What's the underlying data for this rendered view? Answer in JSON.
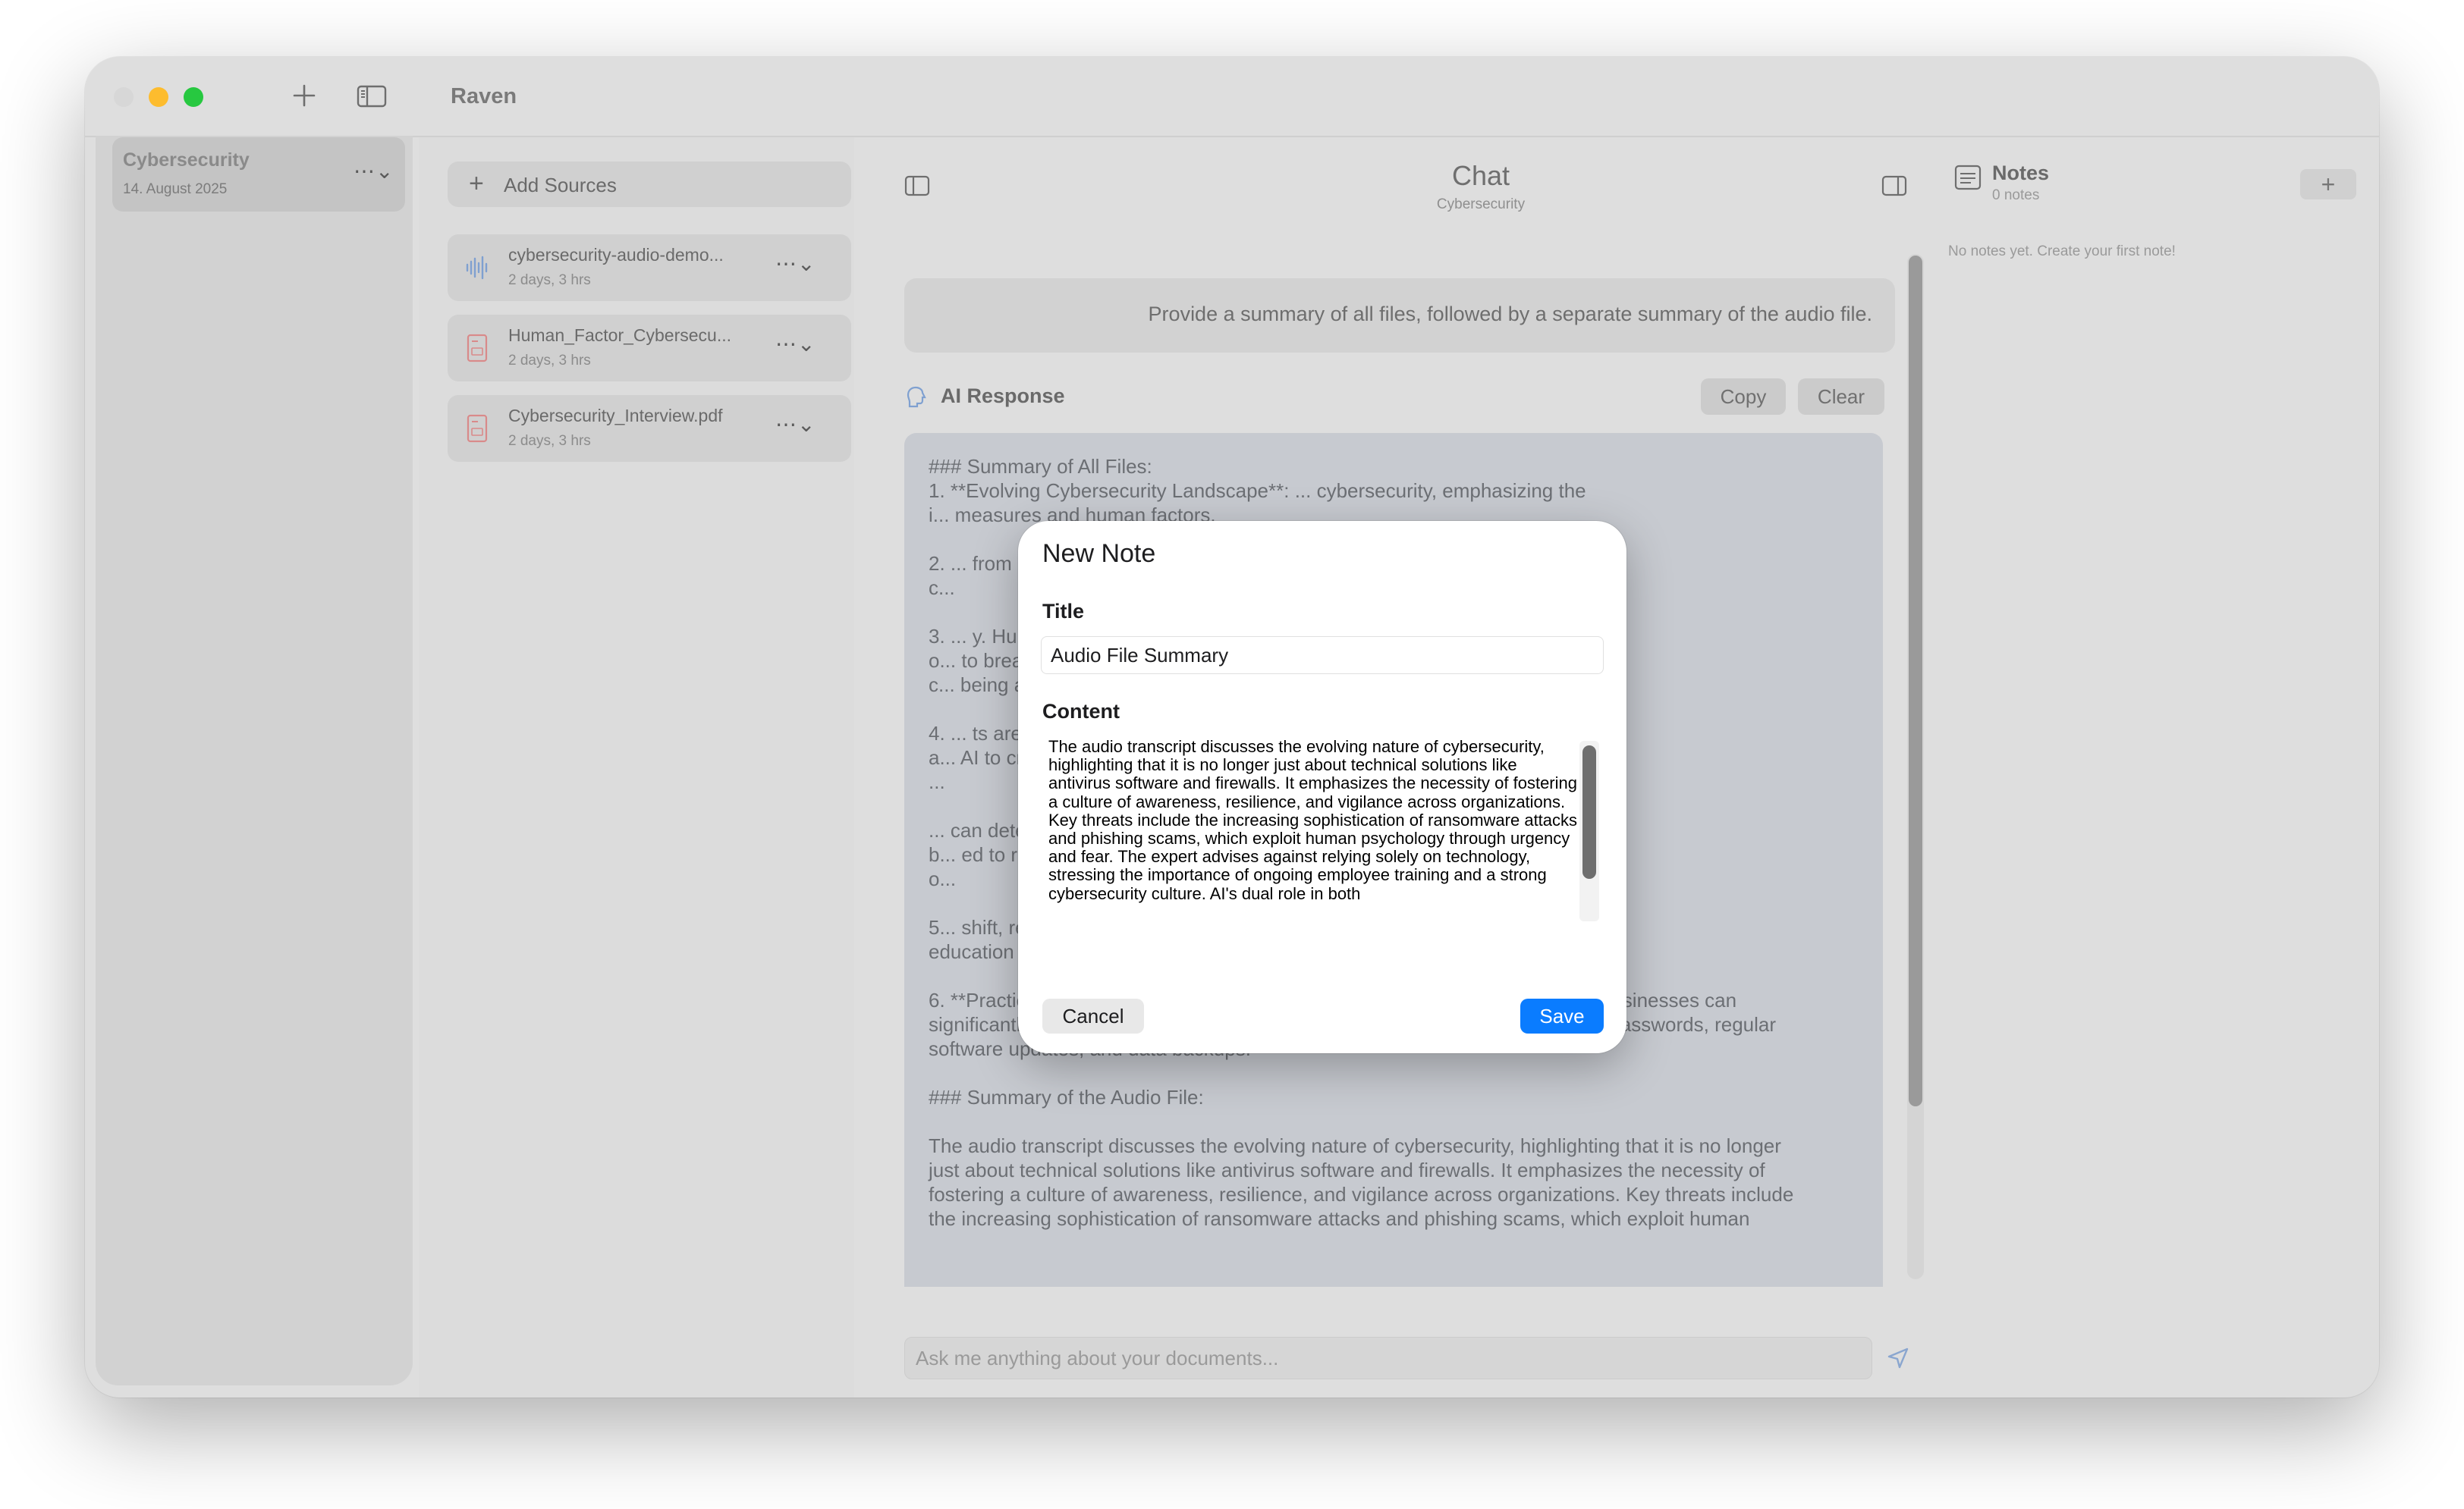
{
  "app": {
    "title": "Raven"
  },
  "sidebar": {
    "projects": [
      {
        "title": "Cybersecurity",
        "date": "14. August 2025"
      }
    ]
  },
  "sources": {
    "add_label": "Add Sources",
    "items": [
      {
        "name": "cybersecurity-audio-demo...",
        "meta": "2 days, 3 hrs",
        "icon": "waveform-icon"
      },
      {
        "name": "Human_Factor_Cybersecu...",
        "meta": "2 days, 3 hrs",
        "icon": "pdf-icon"
      },
      {
        "name": "Cybersecurity_Interview.pdf",
        "meta": "2 days, 3 hrs",
        "icon": "pdf-icon"
      }
    ]
  },
  "chat": {
    "title": "Chat",
    "subtitle": "Cybersecurity",
    "prompt": "Provide a summary of all files, followed by a separate summary of the audio file.",
    "ai_label": "AI Response",
    "copy_label": "Copy",
    "clear_label": "Clear",
    "response_lines": [
      "### Summary of All Files:",
      "1. **Evolving Cybersecurity Landscape**: ... cybersecurity, emphasizing the",
      "i... measures and human factors.",
      "",
      "2. ... from being a mere IT concern to a",
      "c...",
      "",
      "3. ... y. Human error, such as clicking",
      "o... to breaches. Training must be",
      "c... being a yearly checkbox exercise.",
      "",
      "4. ... ts are significant threats, with",
      "a... AI to create highly convincing",
      "...",
      "",
      "... can detect threats in real time,",
      "b... ed to remain agile to counter both",
      "o...",
      "",
      "5... shift, requiring continuous",
      "education and policy alignment with human behavior.",
      "",
      "6. **Practical Advice for Small Businesses**: Despite being vulnerable, small businesses can",
      "significantly reduce risks by implementing basic security measures like strong passwords, regular",
      "software updates, and data backups.",
      "",
      "### Summary of the Audio File:",
      "",
      "The audio transcript discusses the evolving nature of cybersecurity, highlighting that it is no longer",
      "just about technical solutions like antivirus software and firewalls. It emphasizes the necessity of",
      "fostering a culture of awareness, resilience, and vigilance across organizations. Key threats include",
      "the increasing sophistication of ransomware attacks and phishing scams, which exploit human"
    ],
    "input_placeholder": "Ask me anything about your documents..."
  },
  "notes": {
    "title": "Notes",
    "count": "0 notes",
    "empty": "No notes yet. Create your first note!"
  },
  "modal": {
    "title": "New Note",
    "title_label": "Title",
    "title_value": "Audio File Summary",
    "content_label": "Content",
    "content_value": "The audio transcript discusses the evolving nature of cybersecurity, highlighting that it is no longer just about technical solutions like antivirus software and firewalls. It emphasizes the necessity of fostering a culture of awareness, resilience, and vigilance across organizations. Key threats include the increasing sophistication of ransomware attacks and phishing scams, which exploit human psychology through urgency and fear. The expert advises against relying solely on technology, stressing the importance of ongoing employee training and a strong cybersecurity culture. AI's dual role in both",
    "cancel_label": "Cancel",
    "save_label": "Save"
  },
  "colors": {
    "accent": "#0a7cff",
    "traffic_red": "#d7d7d7",
    "traffic_yellow": "#fdbc2e",
    "traffic_green": "#27c840"
  }
}
